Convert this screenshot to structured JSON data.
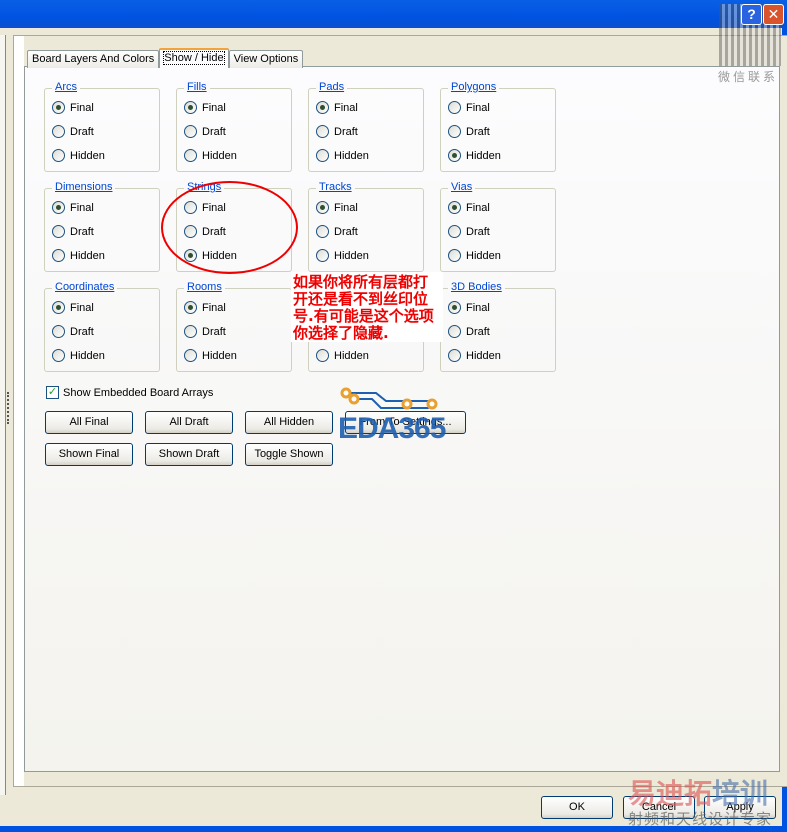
{
  "window": {
    "help_label": "?",
    "close_label": "✕"
  },
  "watermarks": {
    "qr_label": "微信联系",
    "eda_logo": "EDA365",
    "brand": "易迪拓",
    "brand2": "培训",
    "slogan": "射频和天线设计专家"
  },
  "tabs": [
    {
      "label": "Board Layers And Colors"
    },
    {
      "label": "Show / Hide"
    },
    {
      "label": "View Options"
    }
  ],
  "groups": [
    {
      "title": "Arcs",
      "selected": "Final"
    },
    {
      "title": "Fills",
      "selected": "Final"
    },
    {
      "title": "Pads",
      "selected": "Final"
    },
    {
      "title": "Polygons",
      "selected": "Hidden"
    },
    {
      "title": "Dimensions",
      "selected": "Final"
    },
    {
      "title": "Strings",
      "selected": "Hidden"
    },
    {
      "title": "Tracks",
      "selected": "Final"
    },
    {
      "title": "Vias",
      "selected": "Final"
    },
    {
      "title": "Coordinates",
      "selected": "Final"
    },
    {
      "title": "Rooms",
      "selected": "Final"
    },
    {
      "title": "",
      "selected": ""
    },
    {
      "title": "3D Bodies",
      "selected": "Final"
    }
  ],
  "options": [
    "Final",
    "Draft",
    "Hidden"
  ],
  "checkbox": {
    "label": "Show Embedded Board Arrays",
    "checked": true
  },
  "buttons": {
    "all_final": "All Final",
    "all_draft": "All Draft",
    "all_hidden": "All Hidden",
    "from_to": "From To Settings...",
    "shown_final": "Shown Final",
    "shown_draft": "Shown Draft",
    "toggle_shown": "Toggle Shown",
    "ok": "OK",
    "cancel": "Cancel",
    "apply": "Apply"
  },
  "annotation": "如果你将所有层都打开还是看不到丝印位号.有可能是这个选项你选择了隐藏."
}
